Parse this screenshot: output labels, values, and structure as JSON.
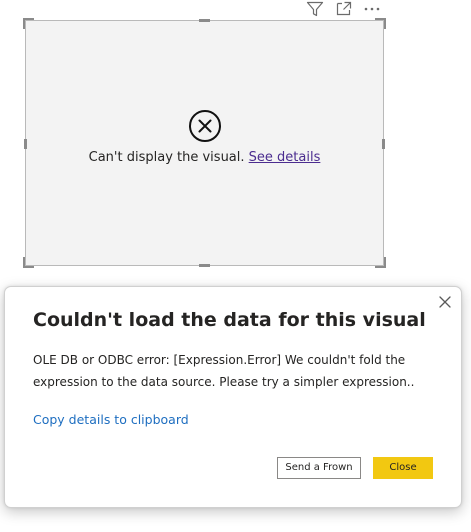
{
  "visual": {
    "header_icons": [
      "filter-icon",
      "focus-mode-icon",
      "more-options-icon"
    ],
    "error_icon": "error-circle-x-icon",
    "error_message": "Can't display the visual.",
    "see_details_label": "See details"
  },
  "dialog": {
    "title": "Couldn't load the data for this visual",
    "body": "OLE DB or ODBC error: [Expression.Error] We couldn't fold the expression to the data source. Please try a simpler expression..",
    "copy_link_label": "Copy details to clipboard",
    "send_frown_label": "Send a Frown",
    "close_label": "Close",
    "close_icon": "close-icon"
  },
  "colors": {
    "visual_background": "#f3f3f3",
    "link_purple": "#4b2c8f",
    "link_blue": "#1e6ec0",
    "primary_button": "#f2c811",
    "text": "#252423"
  }
}
